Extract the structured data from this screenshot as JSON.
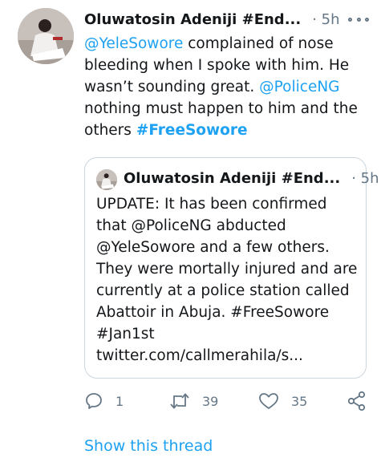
{
  "tweet": {
    "author_name": "Oluwatosin Adeniji #End...",
    "time": "· 5h",
    "text_segments": [
      {
        "type": "mention",
        "text": "@YeleSowore"
      },
      {
        "type": "plain",
        "text": " complained of nose bleeding when I spoke with him. He wasn’t sounding great. "
      },
      {
        "type": "mention",
        "text": "@PoliceNG"
      },
      {
        "type": "plain",
        "text": " nothing must happen to him and the others "
      },
      {
        "type": "hashtag",
        "text": "#FreeSowore"
      }
    ]
  },
  "quoted_tweet": {
    "author_name": "Oluwatosin Adeniji #End...",
    "time": "· 5h",
    "lines": [
      "UPDATE: It has been confirmed",
      "that @PoliceNG abducted",
      "@YeleSowore and a few others.",
      "They were mortally injured and are",
      "currently at a police station called",
      "Abattoir in Abuja. #FreeSowore",
      "#Jan1st",
      "twitter.com/callmerahila/s..."
    ]
  },
  "actions": {
    "reply_count": "1",
    "retweet_count": "39",
    "like_count": "35"
  },
  "show_thread_label": "Show this thread",
  "icons": {
    "reply": "speech-bubble-icon",
    "retweet": "retweet-arrows-icon",
    "like": "heart-icon",
    "share": "share-nodes-icon",
    "more": "more-dots-icon"
  },
  "colors": {
    "link": "#1da1f2",
    "secondary": "#657786",
    "text": "#14171a",
    "border": "#ccd6dd"
  }
}
